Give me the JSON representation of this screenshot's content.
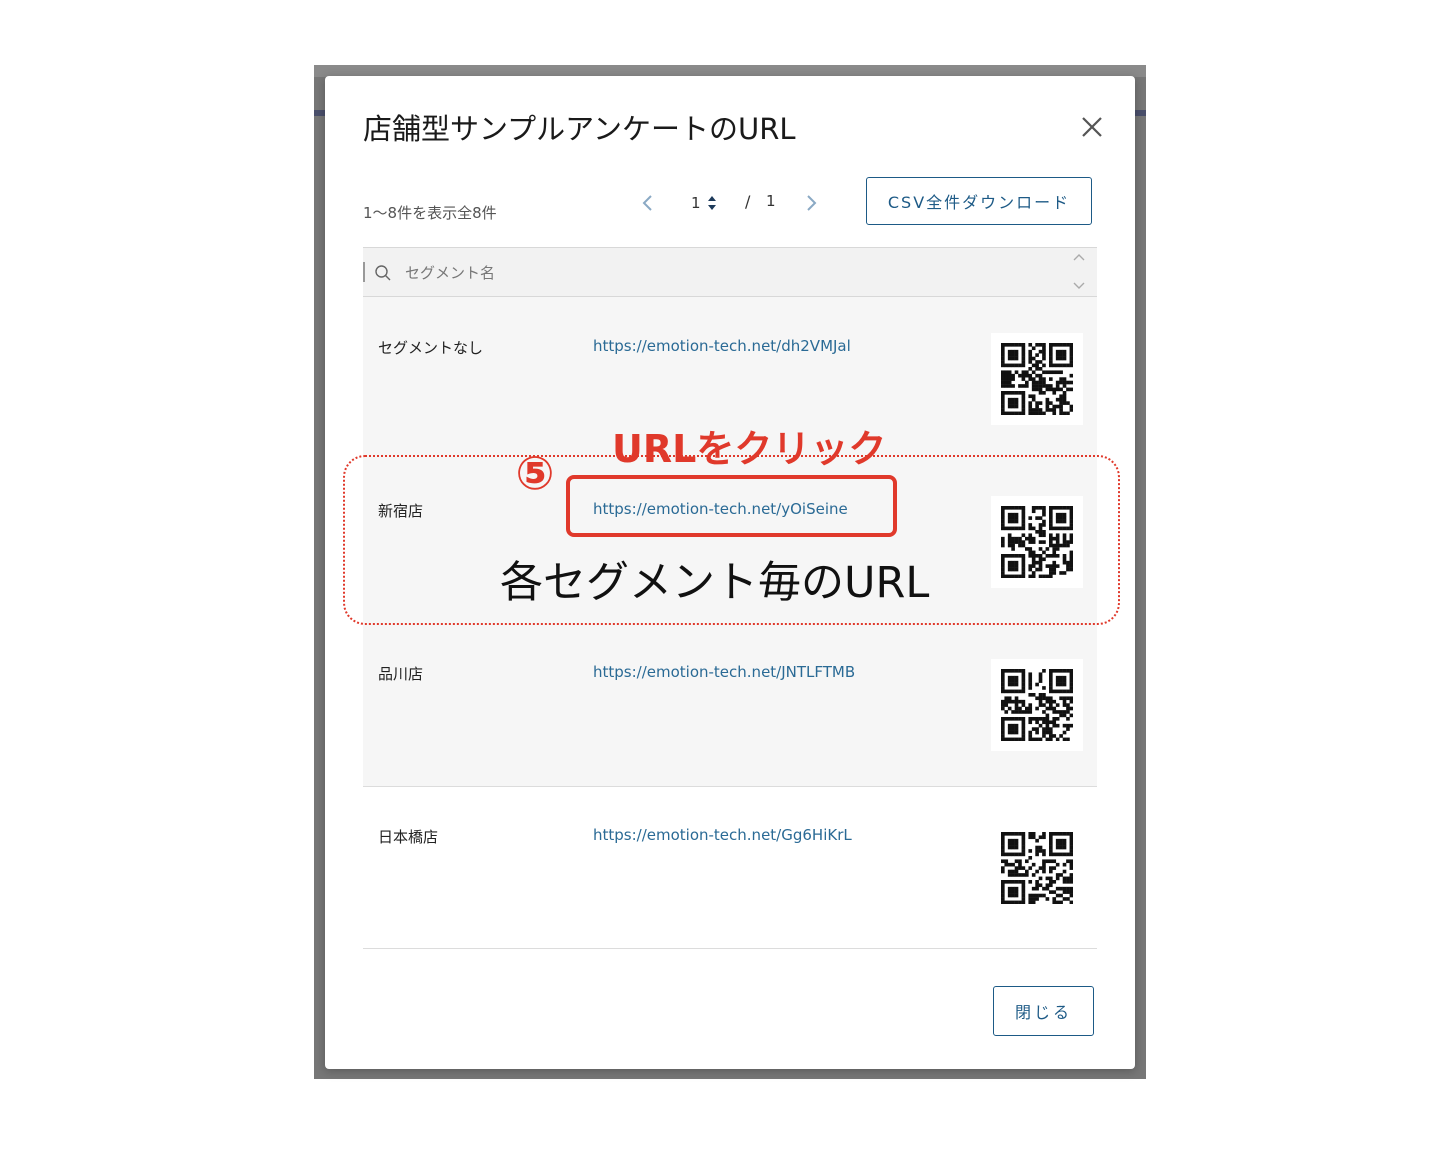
{
  "modal": {
    "title": "店舗型サンプルアンケートのURL",
    "close_icon": "close-icon",
    "count_text": "1〜8件を表示全8件",
    "pagination": {
      "current": "1",
      "separator": "/",
      "total": "1"
    },
    "csv_button": "CSV全件ダウンロード",
    "search": {
      "placeholder": "セグメント名",
      "icon": "search-icon"
    },
    "rows": [
      {
        "segment": "セグメントなし",
        "url": "https://emotion-tech.net/dh2VMJal"
      },
      {
        "segment": "新宿店",
        "url": "https://emotion-tech.net/yOiSeine"
      },
      {
        "segment": "品川店",
        "url": "https://emotion-tech.net/JNTLFTMB"
      },
      {
        "segment": "日本橋店",
        "url": "https://emotion-tech.net/Gg6HiKrL"
      }
    ],
    "close_button": "閉じる"
  },
  "annotation": {
    "number": "⑤",
    "instruction": "URLをクリック",
    "caption": "各セグメント毎のURL",
    "color": "#e0392b"
  }
}
